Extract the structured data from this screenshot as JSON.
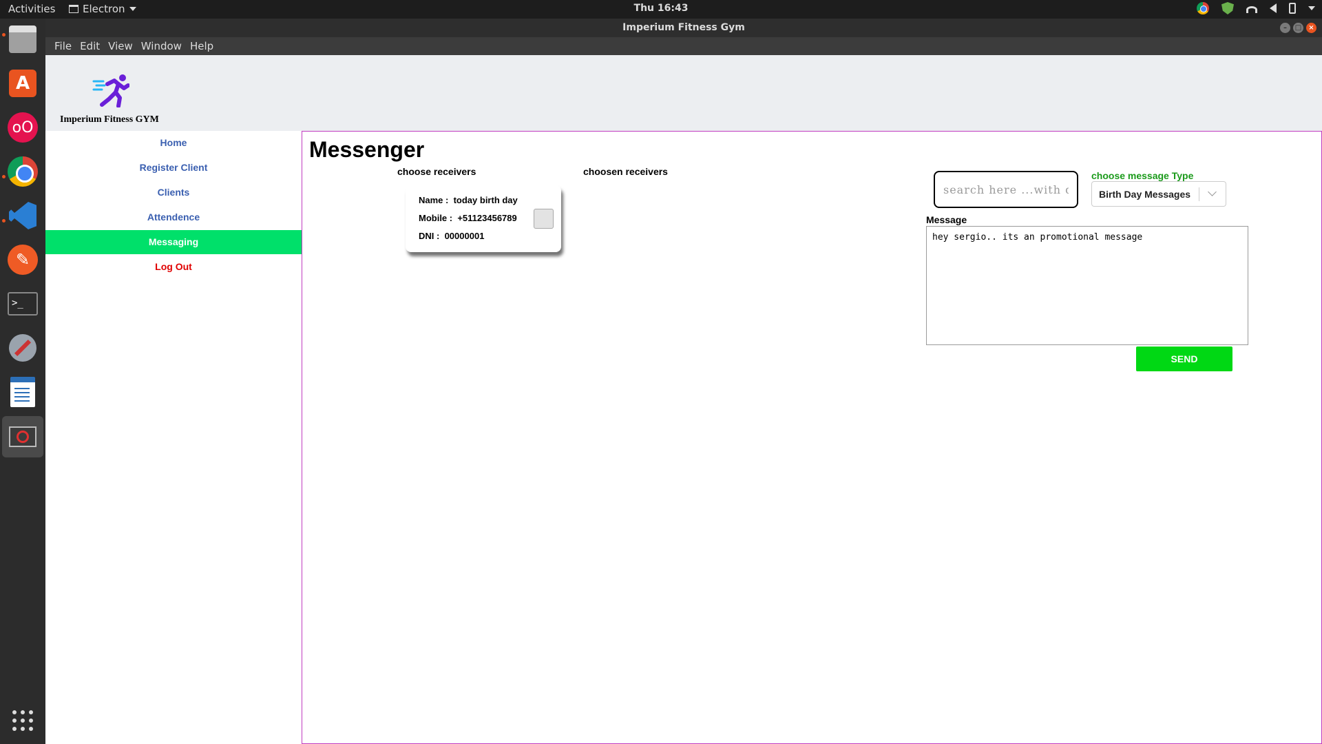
{
  "system_bar": {
    "activities": "Activities",
    "app_name": "Electron",
    "clock": "Thu 16:43"
  },
  "window": {
    "title": "Imperium Fitness Gym"
  },
  "menubar": [
    "File",
    "Edit",
    "View",
    "Window",
    "Help"
  ],
  "brand": {
    "name": "Imperium Fitness GYM",
    "logo_color": "#6a1fd8",
    "logo_accent": "#29b6f6"
  },
  "sidebar": {
    "items": [
      {
        "label": "Home"
      },
      {
        "label": "Register Client"
      },
      {
        "label": "Clients"
      },
      {
        "label": "Attendence"
      },
      {
        "label": "Messaging"
      },
      {
        "label": "Log Out"
      }
    ],
    "active_color": "#00e06a",
    "logout_color": "#e00000"
  },
  "main": {
    "title": "Messenger",
    "choose_label": "choose receivers",
    "chosen_label": "choosen receivers",
    "card": {
      "name_label": "Name :",
      "name_value": "today birth day",
      "mobile_label": "Mobile :",
      "mobile_value": "+51123456789",
      "dni_label": "DNI :",
      "dni_value": "00000001"
    },
    "search_placeholder": "search here ...with dni",
    "type_label": "choose message Type",
    "type_value": "Birth Day Messages",
    "message_label": "Message",
    "message_value": "hey sergio.. its an promotional message",
    "send_label": "SEND",
    "border_color": "#c03ac0",
    "send_color": "#00d814"
  }
}
